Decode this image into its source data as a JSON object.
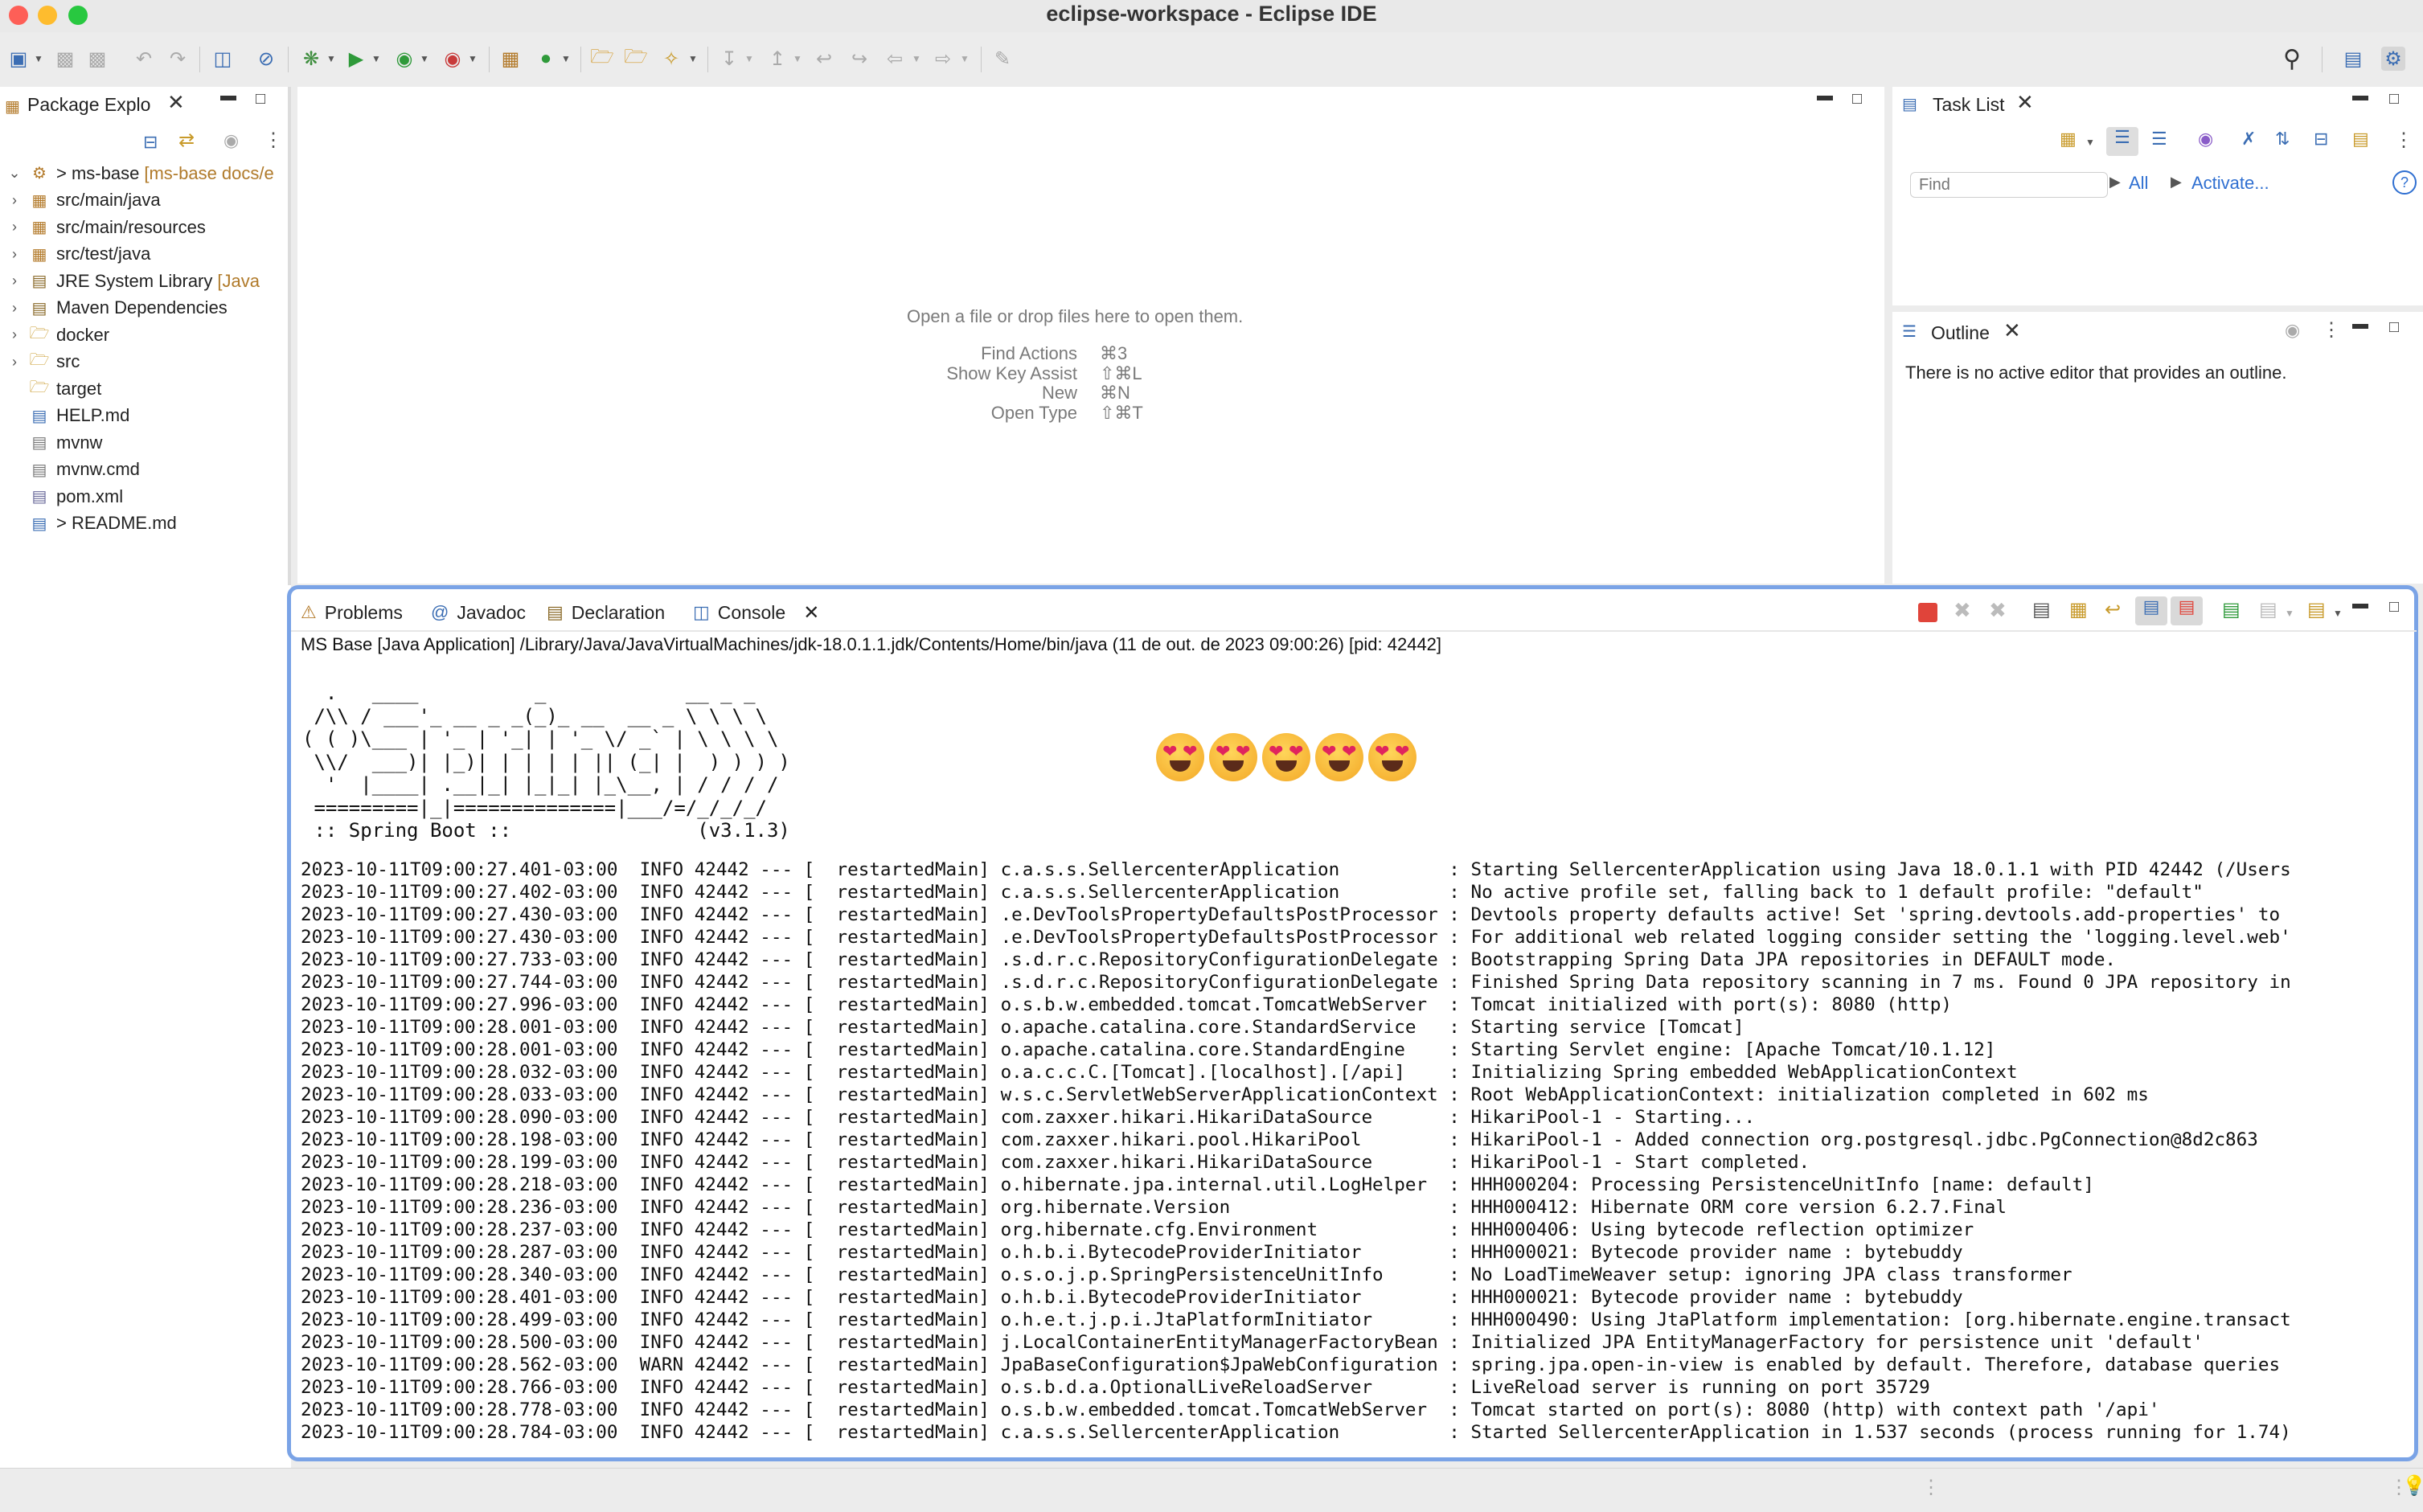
{
  "window": {
    "title": "eclipse-workspace - Eclipse IDE"
  },
  "package_explorer": {
    "title": "Package Explo",
    "items": [
      {
        "label": "> ms-base",
        "deco": "[ms-base docs/e",
        "icon": "project-icon",
        "twisty": "⌄"
      },
      {
        "label": "src/main/java",
        "deco": "",
        "icon": "source-folder-icon",
        "twisty": "›"
      },
      {
        "label": "src/main/resources",
        "deco": "",
        "icon": "source-folder-icon",
        "twisty": "›"
      },
      {
        "label": "src/test/java",
        "deco": "",
        "icon": "source-folder-icon",
        "twisty": "›"
      },
      {
        "label": "JRE System Library",
        "deco": "[Java",
        "icon": "library-icon",
        "twisty": "›"
      },
      {
        "label": "Maven Dependencies",
        "deco": "",
        "icon": "library-icon",
        "twisty": "›"
      },
      {
        "label": "docker",
        "deco": "",
        "icon": "folder-icon",
        "twisty": "›"
      },
      {
        "label": "src",
        "deco": "",
        "icon": "folder-icon",
        "twisty": "›"
      },
      {
        "label": "target",
        "deco": "",
        "icon": "folder-icon",
        "twisty": ""
      },
      {
        "label": "HELP.md",
        "deco": "",
        "icon": "markdown-file-icon",
        "twisty": ""
      },
      {
        "label": "mvnw",
        "deco": "",
        "icon": "file-icon",
        "twisty": ""
      },
      {
        "label": "mvnw.cmd",
        "deco": "",
        "icon": "file-icon",
        "twisty": ""
      },
      {
        "label": "pom.xml",
        "deco": "",
        "icon": "xml-file-icon",
        "twisty": ""
      },
      {
        "label": "> README.md",
        "deco": "",
        "icon": "markdown-file-icon",
        "twisty": ""
      }
    ]
  },
  "editor": {
    "empty_message": "Open a file or drop files here to open them.",
    "shortcuts": [
      {
        "action": "Find Actions",
        "keys": "⌘3"
      },
      {
        "action": "Show Key Assist",
        "keys": "⇧⌘L"
      },
      {
        "action": "New",
        "keys": "⌘N"
      },
      {
        "action": "Open Type",
        "keys": "⇧⌘T"
      }
    ]
  },
  "task_list": {
    "title": "Task List",
    "find_placeholder": "Find",
    "all_label": "All",
    "activate_label": "Activate..."
  },
  "outline": {
    "title": "Outline",
    "message": "There is no active editor that provides an outline."
  },
  "bottom_tabs": [
    {
      "label": "Problems",
      "icon": "problems-icon"
    },
    {
      "label": "Javadoc",
      "icon": "javadoc-icon"
    },
    {
      "label": "Declaration",
      "icon": "declaration-icon"
    },
    {
      "label": "Console",
      "icon": "console-icon"
    }
  ],
  "console": {
    "header": "MS Base [Java Application] /Library/Java/JavaVirtualMachines/jdk-18.0.1.1.jdk/Contents/Home/bin/java  (11 de out. de 2023 09:00:26) [pid: 42442]",
    "banner": [
      "  .   ____          _            __ _ _",
      " /\\\\ / ___'_ __ _ _(_)_ __  __ _ \\ \\ \\ \\",
      "( ( )\\___ | '_ | '_| | '_ \\/ _` | \\ \\ \\ \\",
      " \\\\/  ___)| |_)| | | | | || (_| |  ) ) ) )",
      "  '  |____| .__|_| |_|_| |_\\__, | / / / /",
      " =========|_|==============|___/=/_/_/_/",
      " :: Spring Boot ::                (v3.1.3)"
    ],
    "emoji_count": 5,
    "log_lines": [
      "2023-10-11T09:00:27.401-03:00  INFO 42442 --- [  restartedMain] c.a.s.s.SellercenterApplication          : Starting SellercenterApplication using Java 18.0.1.1 with PID 42442 (/Users",
      "2023-10-11T09:00:27.402-03:00  INFO 42442 --- [  restartedMain] c.a.s.s.SellercenterApplication          : No active profile set, falling back to 1 default profile: \"default\"",
      "2023-10-11T09:00:27.430-03:00  INFO 42442 --- [  restartedMain] .e.DevToolsPropertyDefaultsPostProcessor : Devtools property defaults active! Set 'spring.devtools.add-properties' to",
      "2023-10-11T09:00:27.430-03:00  INFO 42442 --- [  restartedMain] .e.DevToolsPropertyDefaultsPostProcessor : For additional web related logging consider setting the 'logging.level.web'",
      "2023-10-11T09:00:27.733-03:00  INFO 42442 --- [  restartedMain] .s.d.r.c.RepositoryConfigurationDelegate : Bootstrapping Spring Data JPA repositories in DEFAULT mode.",
      "2023-10-11T09:00:27.744-03:00  INFO 42442 --- [  restartedMain] .s.d.r.c.RepositoryConfigurationDelegate : Finished Spring Data repository scanning in 7 ms. Found 0 JPA repository in",
      "2023-10-11T09:00:27.996-03:00  INFO 42442 --- [  restartedMain] o.s.b.w.embedded.tomcat.TomcatWebServer  : Tomcat initialized with port(s): 8080 (http)",
      "2023-10-11T09:00:28.001-03:00  INFO 42442 --- [  restartedMain] o.apache.catalina.core.StandardService   : Starting service [Tomcat]",
      "2023-10-11T09:00:28.001-03:00  INFO 42442 --- [  restartedMain] o.apache.catalina.core.StandardEngine    : Starting Servlet engine: [Apache Tomcat/10.1.12]",
      "2023-10-11T09:00:28.032-03:00  INFO 42442 --- [  restartedMain] o.a.c.c.C.[Tomcat].[localhost].[/api]    : Initializing Spring embedded WebApplicationContext",
      "2023-10-11T09:00:28.033-03:00  INFO 42442 --- [  restartedMain] w.s.c.ServletWebServerApplicationContext : Root WebApplicationContext: initialization completed in 602 ms",
      "2023-10-11T09:00:28.090-03:00  INFO 42442 --- [  restartedMain] com.zaxxer.hikari.HikariDataSource       : HikariPool-1 - Starting...",
      "2023-10-11T09:00:28.198-03:00  INFO 42442 --- [  restartedMain] com.zaxxer.hikari.pool.HikariPool        : HikariPool-1 - Added connection org.postgresql.jdbc.PgConnection@8d2c863",
      "2023-10-11T09:00:28.199-03:00  INFO 42442 --- [  restartedMain] com.zaxxer.hikari.HikariDataSource       : HikariPool-1 - Start completed.",
      "2023-10-11T09:00:28.218-03:00  INFO 42442 --- [  restartedMain] o.hibernate.jpa.internal.util.LogHelper  : HHH000204: Processing PersistenceUnitInfo [name: default]",
      "2023-10-11T09:00:28.236-03:00  INFO 42442 --- [  restartedMain] org.hibernate.Version                    : HHH000412: Hibernate ORM core version 6.2.7.Final",
      "2023-10-11T09:00:28.237-03:00  INFO 42442 --- [  restartedMain] org.hibernate.cfg.Environment            : HHH000406: Using bytecode reflection optimizer",
      "2023-10-11T09:00:28.287-03:00  INFO 42442 --- [  restartedMain] o.h.b.i.BytecodeProviderInitiator        : HHH000021: Bytecode provider name : bytebuddy",
      "2023-10-11T09:00:28.340-03:00  INFO 42442 --- [  restartedMain] o.s.o.j.p.SpringPersistenceUnitInfo      : No LoadTimeWeaver setup: ignoring JPA class transformer",
      "2023-10-11T09:00:28.401-03:00  INFO 42442 --- [  restartedMain] o.h.b.i.BytecodeProviderInitiator        : HHH000021: Bytecode provider name : bytebuddy",
      "2023-10-11T09:00:28.499-03:00  INFO 42442 --- [  restartedMain] o.h.e.t.j.p.i.JtaPlatformInitiator       : HHH000490: Using JtaPlatform implementation: [org.hibernate.engine.transact",
      "2023-10-11T09:00:28.500-03:00  INFO 42442 --- [  restartedMain] j.LocalContainerEntityManagerFactoryBean : Initialized JPA EntityManagerFactory for persistence unit 'default'",
      "2023-10-11T09:00:28.562-03:00  WARN 42442 --- [  restartedMain] JpaBaseConfiguration$JpaWebConfiguration : spring.jpa.open-in-view is enabled by default. Therefore, database queries",
      "2023-10-11T09:00:28.766-03:00  INFO 42442 --- [  restartedMain] o.s.b.d.a.OptionalLiveReloadServer       : LiveReload server is running on port 35729",
      "2023-10-11T09:00:28.778-03:00  INFO 42442 --- [  restartedMain] o.s.b.w.embedded.tomcat.TomcatWebServer  : Tomcat started on port(s): 8080 (http) with context path '/api'",
      "2023-10-11T09:00:28.784-03:00  INFO 42442 --- [  restartedMain] c.a.s.s.SellercenterApplication          : Started SellercenterApplication in 1.537 seconds (process running for 1.74)"
    ]
  },
  "colors": {
    "accent": "#7aa3e6",
    "link": "#2f6fd1",
    "terminate": "#e0443a",
    "decoration": "#b07a2a"
  }
}
